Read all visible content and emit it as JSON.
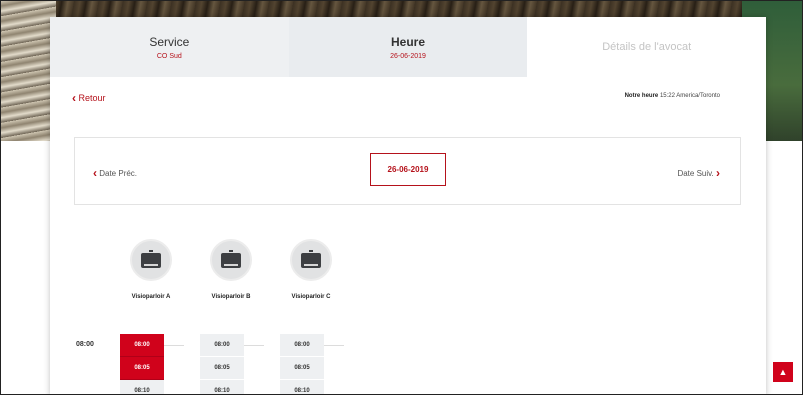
{
  "steps": [
    {
      "title": "Service",
      "sub": "CO Sud"
    },
    {
      "title": "Heure",
      "sub": "26-06-2019"
    },
    {
      "title": "Détails de l'avocat",
      "sub": ""
    }
  ],
  "nav": {
    "back_label": "Retour",
    "time_note_label": "Notre heure",
    "time_note_value": "15:22 America/Toronto"
  },
  "date_picker": {
    "prev_label": "Date Préc.",
    "next_label": "Date Suiv.",
    "current_date": "26-06-2019"
  },
  "rooms": [
    {
      "name": "Visioparloir A",
      "slots": [
        "08:00",
        "08:05",
        "08:10"
      ],
      "selected": [
        "08:00",
        "08:05"
      ]
    },
    {
      "name": "Visioparloir B",
      "slots": [
        "08:00",
        "08:05",
        "08:10"
      ],
      "selected": []
    },
    {
      "name": "Visioparloir C",
      "slots": [
        "08:00",
        "08:05",
        "08:10"
      ],
      "selected": []
    }
  ],
  "row_label": "08:00",
  "icons": {
    "back": "chevron-left-icon",
    "prev": "chevron-left-icon",
    "next": "chevron-right-icon",
    "room": "monitor-icon",
    "scroll_top": "chevron-up-icon"
  },
  "colors": {
    "accent": "#d0021b",
    "step_bg": "#eef0f2"
  }
}
